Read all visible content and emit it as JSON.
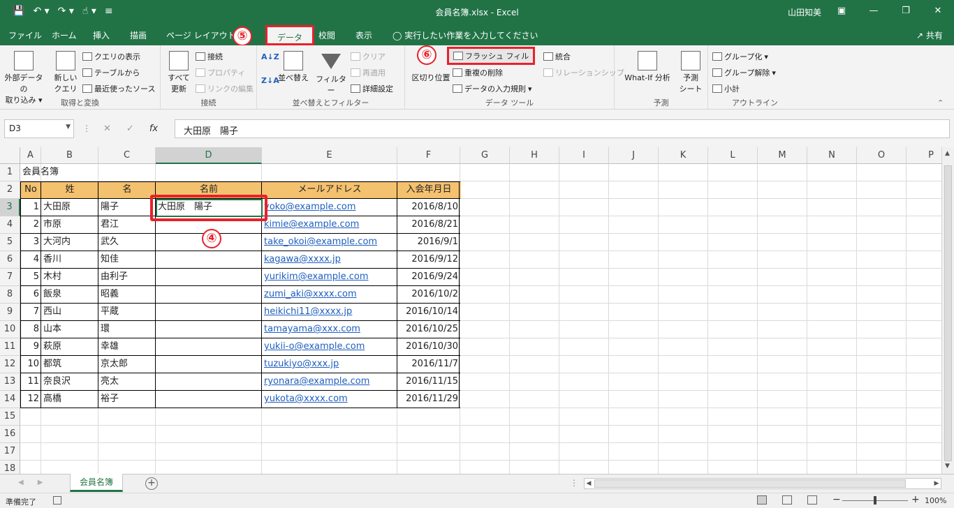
{
  "window": {
    "title": "会員名簿.xlsx  -  Excel",
    "user": "山田知美"
  },
  "tabs": [
    "ファイル",
    "ホーム",
    "挿入",
    "描画",
    "ページ レイアウト",
    "データ",
    "校閲",
    "表示"
  ],
  "tell_me": "実行したい作業を入力してください",
  "share": "共有",
  "callouts": [
    "⑤",
    "⑥",
    "④"
  ],
  "ribbon": {
    "get_data": {
      "external": "外部データの\n取り込み",
      "new_query": "新しい\nクエリ",
      "show_queries": "クエリの表示",
      "from_table": "テーブルから",
      "recent_sources": "最近使ったソース",
      "group": "取得と変換"
    },
    "connections": {
      "refresh_all": "すべて\n更新",
      "connections": "接続",
      "properties": "プロパティ",
      "edit_links": "リンクの編集",
      "group": "接続"
    },
    "sort_filter": {
      "sort": "並べ替え",
      "filter": "フィルター",
      "clear": "クリア",
      "reapply": "再適用",
      "advanced": "詳細設定",
      "group": "並べ替えとフィルター"
    },
    "data_tools": {
      "text_to_columns": "区切り位置",
      "flash_fill": "フラッシュ フィル",
      "remove_duplicates": "重複の削除",
      "data_validation": "データの入力規則",
      "consolidate": "統合",
      "relationships": "リレーションシップ",
      "group": "データ ツール"
    },
    "forecast": {
      "whatif": "What-If 分析",
      "forecast_sheet": "予測\nシート",
      "group": "予測"
    },
    "outline": {
      "group_btn": "グループ化",
      "ungroup": "グループ解除",
      "subtotal": "小計",
      "group": "アウトライン"
    }
  },
  "formula_bar": {
    "name_box": "D3",
    "fx": "fx",
    "value": "大田原　陽子"
  },
  "columns": [
    "A",
    "B",
    "C",
    "D",
    "E",
    "F",
    "G",
    "H",
    "I",
    "J",
    "K",
    "L",
    "M",
    "N",
    "O",
    "P"
  ],
  "rows": [
    "1",
    "2",
    "3",
    "4",
    "5",
    "6",
    "7",
    "8",
    "9",
    "10",
    "11",
    "12",
    "13",
    "14",
    "15",
    "16",
    "17",
    "18"
  ],
  "sheet": {
    "title": "会員名簿",
    "headers": [
      "No",
      "姓",
      "名",
      "名前",
      "メールアドレス",
      "入会年月日"
    ],
    "records": [
      [
        "1",
        "大田原",
        "陽子",
        "大田原　陽子",
        "yoko@example.com",
        "2016/8/10"
      ],
      [
        "2",
        "市原",
        "君江",
        "",
        "kimie@example.com",
        "2016/8/21"
      ],
      [
        "3",
        "大河内",
        "武久",
        "",
        "take_okoi@example.com",
        "2016/9/1"
      ],
      [
        "4",
        "香川",
        "知佳",
        "",
        "kagawa@xxxx.jp",
        "2016/9/12"
      ],
      [
        "5",
        "木村",
        "由利子",
        "",
        "yurikim@example.com",
        "2016/9/24"
      ],
      [
        "6",
        "飯泉",
        "昭義",
        "",
        "zumi_aki@xxxx.com",
        "2016/10/2"
      ],
      [
        "7",
        "西山",
        "平蔵",
        "",
        "heikichi11@xxxx.jp",
        "2016/10/14"
      ],
      [
        "8",
        "山本",
        "環",
        "",
        "tamayama@xxx.com",
        "2016/10/25"
      ],
      [
        "9",
        "萩原",
        "幸雄",
        "",
        "yukii-o@example.com",
        "2016/10/30"
      ],
      [
        "10",
        "都筑",
        "京太郎",
        "",
        "tuzukiyo@xxx.jp",
        "2016/11/7"
      ],
      [
        "11",
        "奈良沢",
        "亮太",
        "",
        "ryonara@example.com",
        "2016/11/15"
      ],
      [
        "12",
        "高橋",
        "裕子",
        "",
        "yukota@xxxx.com",
        "2016/11/29"
      ]
    ]
  },
  "sheet_tab": "会員名簿",
  "status": {
    "ready": "準備完了",
    "zoom": "100%"
  }
}
